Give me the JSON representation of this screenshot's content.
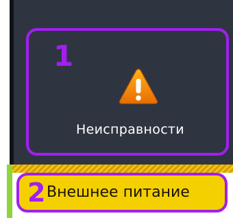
{
  "fault_tile": {
    "callout": "1",
    "label": "Неисправности",
    "icon": "warning-triangle-icon"
  },
  "power_button": {
    "callout": "2",
    "label": "Внешнее питание"
  },
  "colors": {
    "panel_bg": "#2f3540",
    "highlight": "#a21ff0",
    "warning_orange": "#f08c00",
    "button_yellow": "#f5d000",
    "status_green": "#8fd43b"
  }
}
